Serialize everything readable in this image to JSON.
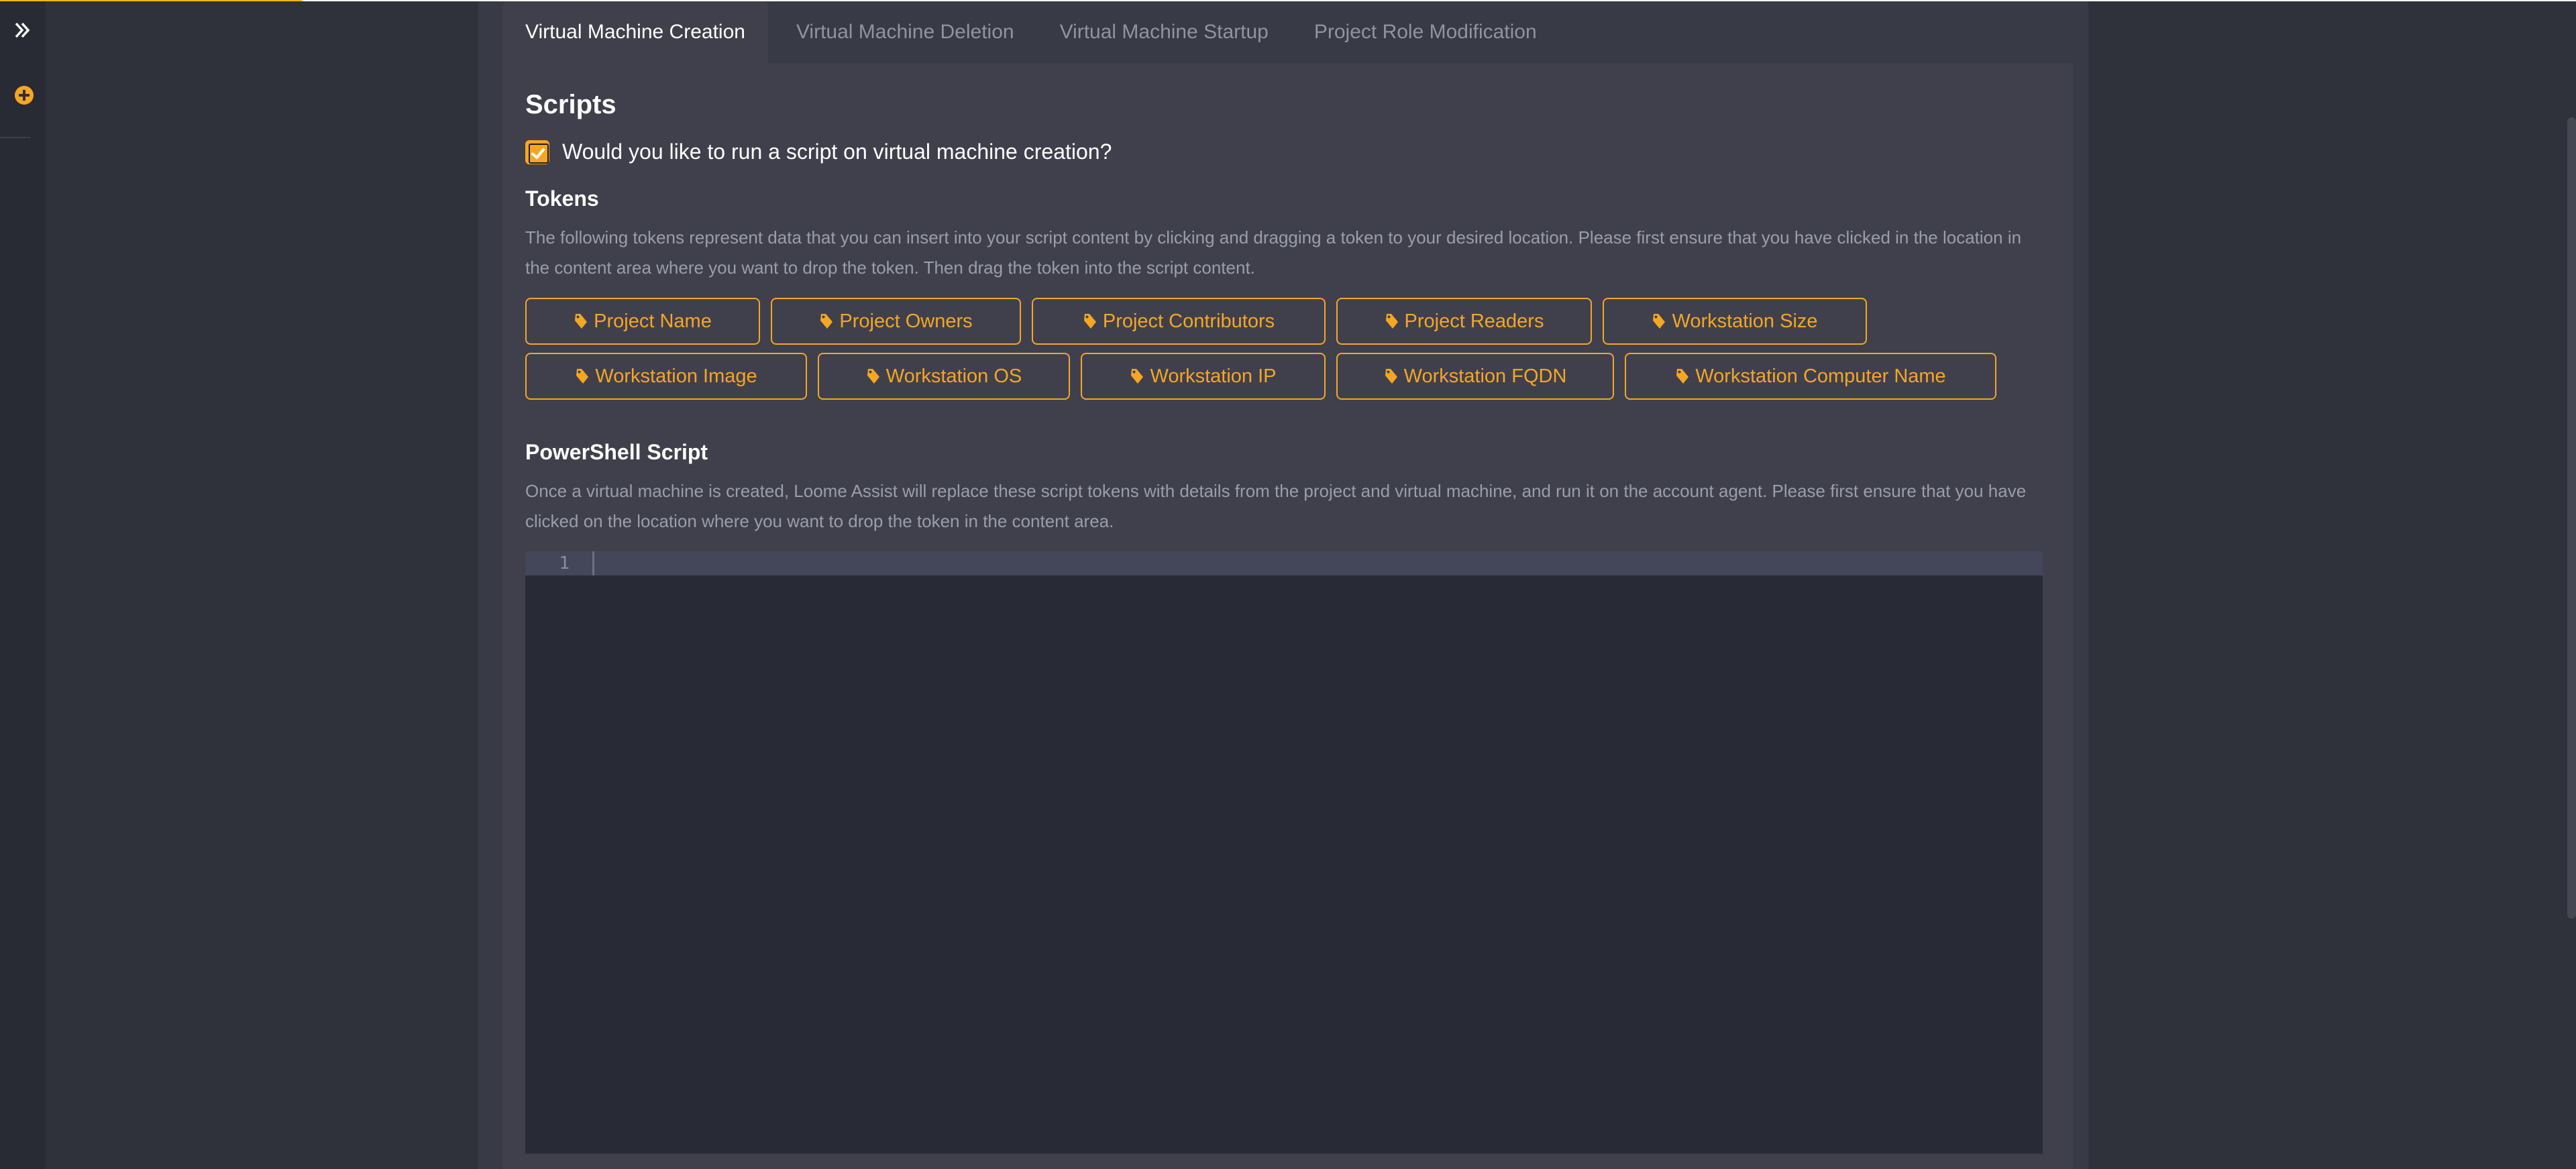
{
  "sidebar": {
    "expand_icon": "double-chevron-right-icon",
    "add_icon": "plus-circle-icon"
  },
  "tabs": [
    {
      "label": "Virtual Machine Creation",
      "active": true
    },
    {
      "label": "Virtual Machine Deletion",
      "active": false
    },
    {
      "label": "Virtual Machine Startup",
      "active": false
    },
    {
      "label": "Project Role Modification",
      "active": false
    }
  ],
  "scripts": {
    "title": "Scripts",
    "run_script_checkbox": {
      "label": "Would you like to run a script on virtual machine creation?",
      "checked": true
    },
    "tokens": {
      "title": "Tokens",
      "help": "The following tokens represent data that you can insert into your script content by clicking and dragging a token to your desired location. Please first ensure that you have clicked in the location in the content area where you want to drop the token. Then drag the token into the script content.",
      "icon": "tag-icon",
      "rows": [
        [
          "Project Name",
          "Project Owners",
          "Project Contributors",
          "Project Readers",
          "Workstation Size"
        ],
        [
          "Workstation Image",
          "Workstation OS",
          "Workstation IP",
          "Workstation FQDN",
          "Workstation Computer Name"
        ]
      ]
    },
    "powershell": {
      "title": "PowerShell Script",
      "help": "Once a virtual machine is created, Loome Assist will replace these script tokens with details from the project and virtual machine, and run it on the account agent. Please first ensure that you have clicked on the location where you want to drop the token in the content area.",
      "line_number": "1",
      "content": ""
    }
  },
  "colors": {
    "accent": "#f5a623",
    "background": "#2f323b",
    "panel": "#383a45",
    "content": "#40404d",
    "editor": "#282a36",
    "active_line": "#44475a"
  }
}
